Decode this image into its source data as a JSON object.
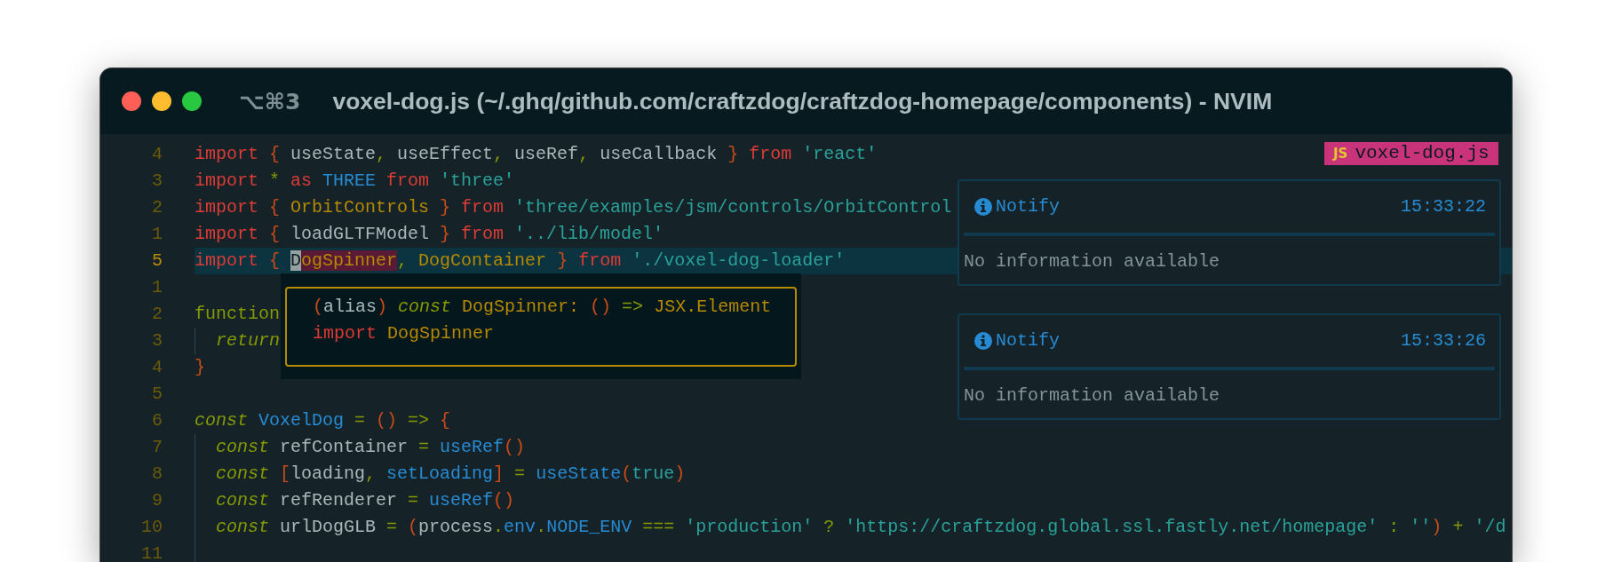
{
  "window": {
    "shortcut": "⌥⌘3",
    "title": "voxel-dog.js (~/.ghq/github.com/craftzdog/craftzdog-homepage/components) - NVIM"
  },
  "editor": {
    "lines": [
      {
        "number": "4",
        "current": false,
        "tokens": [
          {
            "text": "import",
            "kind": "keyword"
          },
          {
            "text": " { ",
            "kind": "punct"
          },
          {
            "text": "useState",
            "kind": "variable"
          },
          {
            "text": ", ",
            "kind": "operator"
          },
          {
            "text": "useEffect",
            "kind": "variable"
          },
          {
            "text": ", ",
            "kind": "operator"
          },
          {
            "text": "useRef",
            "kind": "variable"
          },
          {
            "text": ", ",
            "kind": "operator"
          },
          {
            "text": "useCallback",
            "kind": "variable"
          },
          {
            "text": " } ",
            "kind": "punct"
          },
          {
            "text": "from",
            "kind": "keyword"
          },
          {
            "text": " 'react'",
            "kind": "string"
          }
        ]
      },
      {
        "number": "3",
        "current": false,
        "tokens": [
          {
            "text": "import",
            "kind": "keyword"
          },
          {
            "text": " * ",
            "kind": "operator"
          },
          {
            "text": "as",
            "kind": "keyword"
          },
          {
            "text": " THREE ",
            "kind": "constant"
          },
          {
            "text": "from",
            "kind": "keyword"
          },
          {
            "text": " 'three'",
            "kind": "string"
          }
        ]
      },
      {
        "number": "2",
        "current": false,
        "tokens": [
          {
            "text": "import",
            "kind": "keyword"
          },
          {
            "text": " { ",
            "kind": "punct"
          },
          {
            "text": "OrbitControls",
            "kind": "type"
          },
          {
            "text": " } ",
            "kind": "punct"
          },
          {
            "text": "from",
            "kind": "keyword"
          },
          {
            "text": " 'three/examples/jsm/controls/OrbitControl",
            "kind": "string"
          }
        ]
      },
      {
        "number": "1",
        "current": false,
        "tokens": [
          {
            "text": "import",
            "kind": "keyword"
          },
          {
            "text": " { ",
            "kind": "punct"
          },
          {
            "text": "loadGLTFModel",
            "kind": "variable"
          },
          {
            "text": " } ",
            "kind": "punct"
          },
          {
            "text": "from",
            "kind": "keyword"
          },
          {
            "text": " '../lib/model'",
            "kind": "string"
          }
        ]
      },
      {
        "number": "5",
        "current": true,
        "tokens": [
          {
            "text": "import",
            "kind": "keyword"
          },
          {
            "text": " { ",
            "kind": "punct"
          },
          {
            "text": "D",
            "kind": "type",
            "cursor": true
          },
          {
            "text": "ogSpinner",
            "kind": "type",
            "reference": true
          },
          {
            "text": ", ",
            "kind": "operator"
          },
          {
            "text": "DogContainer",
            "kind": "type"
          },
          {
            "text": " } ",
            "kind": "punct"
          },
          {
            "text": "from",
            "kind": "keyword"
          },
          {
            "text": " './voxel-dog-loader'",
            "kind": "string"
          }
        ]
      },
      {
        "number": "1",
        "current": false
      },
      {
        "number": "2",
        "current": false,
        "tokens": [
          {
            "text": "function",
            "kind": "declaration"
          }
        ]
      },
      {
        "number": "3",
        "current": false,
        "indent_guide": true,
        "tokens": [
          {
            "text": "return",
            "kind": "storage"
          }
        ]
      },
      {
        "number": "4",
        "current": false,
        "tokens": [
          {
            "text": "}",
            "kind": "punct"
          }
        ]
      },
      {
        "number": "5",
        "current": false
      },
      {
        "number": "6",
        "current": false,
        "tokens": [
          {
            "text": "const",
            "kind": "storage"
          },
          {
            "text": " VoxelDog",
            "kind": "constant"
          },
          {
            "text": " = ",
            "kind": "operator"
          },
          {
            "text": "()",
            "kind": "punct"
          },
          {
            "text": " => ",
            "kind": "operator"
          },
          {
            "text": "{",
            "kind": "punct"
          }
        ]
      },
      {
        "number": "7",
        "current": false,
        "indent_guide": true,
        "tokens": [
          {
            "text": "const",
            "kind": "storage"
          },
          {
            "text": " refContainer",
            "kind": "variable"
          },
          {
            "text": " = ",
            "kind": "operator"
          },
          {
            "text": "useRef",
            "kind": "constant"
          },
          {
            "text": "()",
            "kind": "punct"
          }
        ]
      },
      {
        "number": "8",
        "current": false,
        "indent_guide": true,
        "tokens": [
          {
            "text": "const",
            "kind": "storage"
          },
          {
            "text": " [",
            "kind": "punct"
          },
          {
            "text": "loading",
            "kind": "variable"
          },
          {
            "text": ", ",
            "kind": "operator"
          },
          {
            "text": "setLoading",
            "kind": "constant"
          },
          {
            "text": "]",
            "kind": "punct"
          },
          {
            "text": " = ",
            "kind": "operator"
          },
          {
            "text": "useState",
            "kind": "constant"
          },
          {
            "text": "(",
            "kind": "punct"
          },
          {
            "text": "true",
            "kind": "string"
          },
          {
            "text": ")",
            "kind": "punct"
          }
        ]
      },
      {
        "number": "9",
        "current": false,
        "indent_guide": true,
        "tokens": [
          {
            "text": "const",
            "kind": "storage"
          },
          {
            "text": " refRenderer",
            "kind": "variable"
          },
          {
            "text": " = ",
            "kind": "operator"
          },
          {
            "text": "useRef",
            "kind": "constant"
          },
          {
            "text": "()",
            "kind": "punct"
          }
        ]
      },
      {
        "number": "10",
        "current": false,
        "indent_guide": true,
        "tokens": [
          {
            "text": "const",
            "kind": "storage"
          },
          {
            "text": " urlDogGLB",
            "kind": "variable"
          },
          {
            "text": " = ",
            "kind": "operator"
          },
          {
            "text": "(",
            "kind": "punct"
          },
          {
            "text": "process",
            "kind": "variable"
          },
          {
            "text": ".",
            "kind": "operator"
          },
          {
            "text": "env",
            "kind": "constant"
          },
          {
            "text": ".",
            "kind": "operator"
          },
          {
            "text": "NODE_ENV",
            "kind": "constant"
          },
          {
            "text": " === ",
            "kind": "operator"
          },
          {
            "text": "'production'",
            "kind": "string"
          },
          {
            "text": " ? ",
            "kind": "operator"
          },
          {
            "text": "'https://craftzdog.global.ssl.fastly.net/homepage'",
            "kind": "string"
          },
          {
            "text": " : ",
            "kind": "operator"
          },
          {
            "text": "''",
            "kind": "string"
          },
          {
            "text": ")",
            "kind": "punct"
          },
          {
            "text": " + ",
            "kind": "operator"
          },
          {
            "text": "'/d",
            "kind": "string"
          }
        ]
      },
      {
        "number": "11",
        "current": false,
        "indent_guide": true
      }
    ]
  },
  "file_tab": {
    "icon": "JS",
    "name": "voxel-dog.js"
  },
  "hover": {
    "lines": [
      {
        "tokens": [
          {
            "text": "(",
            "kind": "punct"
          },
          {
            "text": "alias",
            "kind": "variable"
          },
          {
            "text": ")",
            "kind": "punct"
          },
          {
            "text": " const",
            "kind": "storage"
          },
          {
            "text": " DogSpinner: ",
            "kind": "type"
          },
          {
            "text": "()",
            "kind": "punct"
          },
          {
            "text": " => ",
            "kind": "operator"
          },
          {
            "text": "JSX.Element",
            "kind": "type"
          }
        ]
      },
      {
        "tokens": [
          {
            "text": "import",
            "kind": "keyword"
          },
          {
            "text": " DogSpinner",
            "kind": "type"
          }
        ]
      }
    ]
  },
  "notifications": [
    {
      "title": "Notify",
      "time": "15:33:22",
      "message": "No information available"
    },
    {
      "title": "Notify",
      "time": "15:33:26",
      "message": "No information available"
    }
  ]
}
